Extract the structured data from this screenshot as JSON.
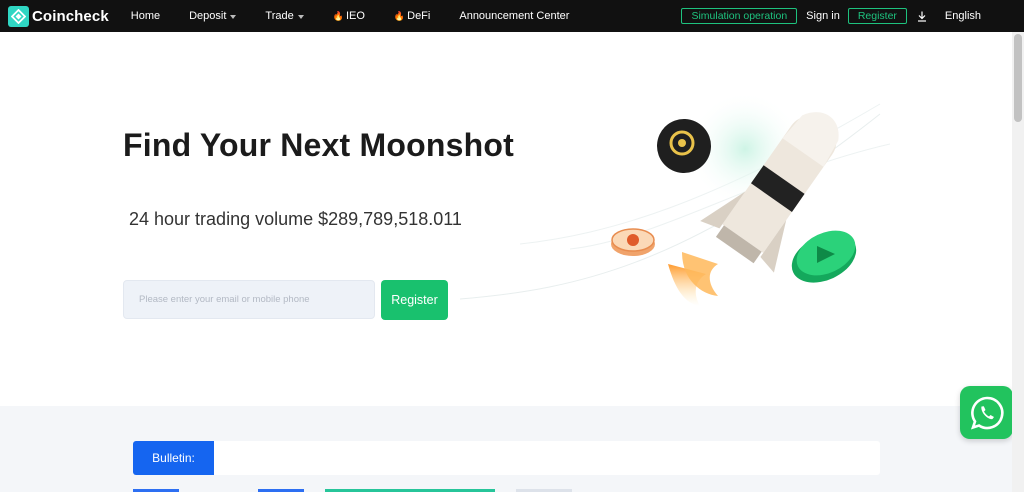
{
  "brand": {
    "name": "Coincheck"
  },
  "nav": {
    "items": [
      {
        "label": "Home",
        "dropdown": false,
        "hot": false
      },
      {
        "label": "Deposit",
        "dropdown": true,
        "hot": false
      },
      {
        "label": "Trade",
        "dropdown": true,
        "hot": false
      },
      {
        "label": "IEO",
        "dropdown": false,
        "hot": true
      },
      {
        "label": "DeFi",
        "dropdown": false,
        "hot": true
      },
      {
        "label": "Announcement Center",
        "dropdown": false,
        "hot": false
      }
    ],
    "simulation_label": "Simulation operation",
    "signin_label": "Sign in",
    "register_label": "Register",
    "download_icon": "download-icon",
    "language_label": "English"
  },
  "hero": {
    "title": "Find Your Next Moonshot",
    "volume_text": "24 hour trading volume $289,789,518.011",
    "input_placeholder": "Please enter your email or mobile phone",
    "register_button": "Register"
  },
  "bulletin": {
    "label": "Bulletin:"
  },
  "colors": {
    "accent_green": "#19c16e",
    "nav_bg": "#111111",
    "bulletin_blue": "#1565f0",
    "logo_teal": "#2fd6c3"
  }
}
